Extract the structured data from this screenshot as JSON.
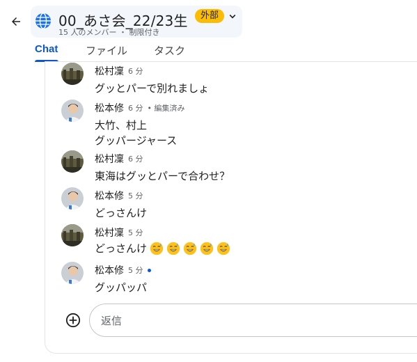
{
  "header": {
    "title": "00_あさ会_22/23生",
    "badge": "外部",
    "subtitle": "15 人のメンバー ・ 制限付き"
  },
  "tabs": [
    {
      "label": "Chat",
      "active": true
    },
    {
      "label": "ファイル",
      "active": false
    },
    {
      "label": "タスク",
      "active": false
    }
  ],
  "messages": [
    {
      "sender": "松村凜",
      "time": "6 分",
      "lines": [
        "グッとパーで別れましょ"
      ],
      "avatar": "landscape-photo"
    },
    {
      "sender": "松本修",
      "time": "6 分",
      "edited": "• 編集済み",
      "lines": [
        "大竹、村上",
        "グッパージャース"
      ],
      "avatar": "person-photo"
    },
    {
      "sender": "松村凜",
      "time": "6 分",
      "lines": [
        "東海はグッとパーで合わせ？"
      ],
      "avatar": "landscape-photo"
    },
    {
      "sender": "松本修",
      "time": "5 分",
      "lines": [
        "どっさんけ"
      ],
      "avatar": "person-photo"
    },
    {
      "sender": "松村凜",
      "time": "5 分",
      "lines": [
        "どっさんけ"
      ],
      "emoji_count": 5,
      "emoji": "grinning-sweat-emoji",
      "avatar": "landscape-photo"
    },
    {
      "sender": "松本修",
      "time": "5 分",
      "lines": [
        "グッパッパ"
      ],
      "unread_dot": true,
      "avatar": "person-photo"
    }
  ],
  "composer": {
    "placeholder": "返信"
  },
  "colors": {
    "accent": "#0b57d0",
    "badge": "#fbbc04",
    "chip_bg": "#f3f6fb"
  }
}
